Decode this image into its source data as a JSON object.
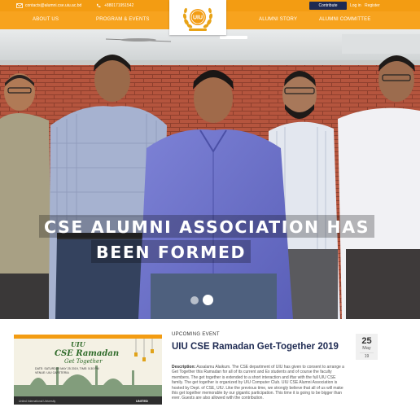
{
  "topbar": {
    "email": "contacts@alumni.cse.uiu.ac.bd",
    "phone": "+880171951542",
    "contribute_label": "Contribute",
    "login_label": "Log in",
    "register_label": "Register"
  },
  "nav": {
    "items": [
      {
        "label": "ABOUT US"
      },
      {
        "label": "PROGRAM & EVENTS"
      },
      {
        "label": "ALUMNI STORY"
      },
      {
        "label": "ALUMNI COMMITTEE"
      }
    ],
    "logo_text": "UIU"
  },
  "hero": {
    "title_line1": "CSE ALUMNI ASSOCIATION HAS",
    "title_line2": "BEEN FORMED"
  },
  "news": {
    "category": "UPCOMING EVENT",
    "title": "UIU CSE Ramadan Get-Together 2019",
    "description_label": "Description:",
    "description": " Assalamu Alaikum. The CSE department of UIU has given to consent to arrange a Get Together this Ramadan for all of its current and Ex students and of course the faculty members. The get together is extended to a short interaction and iftar with the full UIU CSE family. The get together is organized by UIU Computer Club. UIU CSE Alumni Association is hosted by Dept. of CSE, UIU. Like the previous time, we strongly believe that all of us will make this get together memorable by our gigantic participation. This time it is going to be bigger than ever. Guests are also allowed with the contribution.",
    "thumb": {
      "line1": "UIU",
      "line2": "CSE Ramadan",
      "line3": "Get Together",
      "details_line1": "DATE: SATURDAY MAY 25 2019, TIME: 5:30 PM",
      "details_line2": "VENUE: UIU CAFETERIA",
      "footer_left": "United International University",
      "footer_right": "UNITED"
    },
    "date": {
      "day": "25",
      "month": "May",
      "year": "19"
    }
  },
  "colors": {
    "orange_top": "#f39c12",
    "orange_nav": "#f7a31e",
    "navy": "#1e2a52",
    "green_poster": "#2f6b2a"
  }
}
